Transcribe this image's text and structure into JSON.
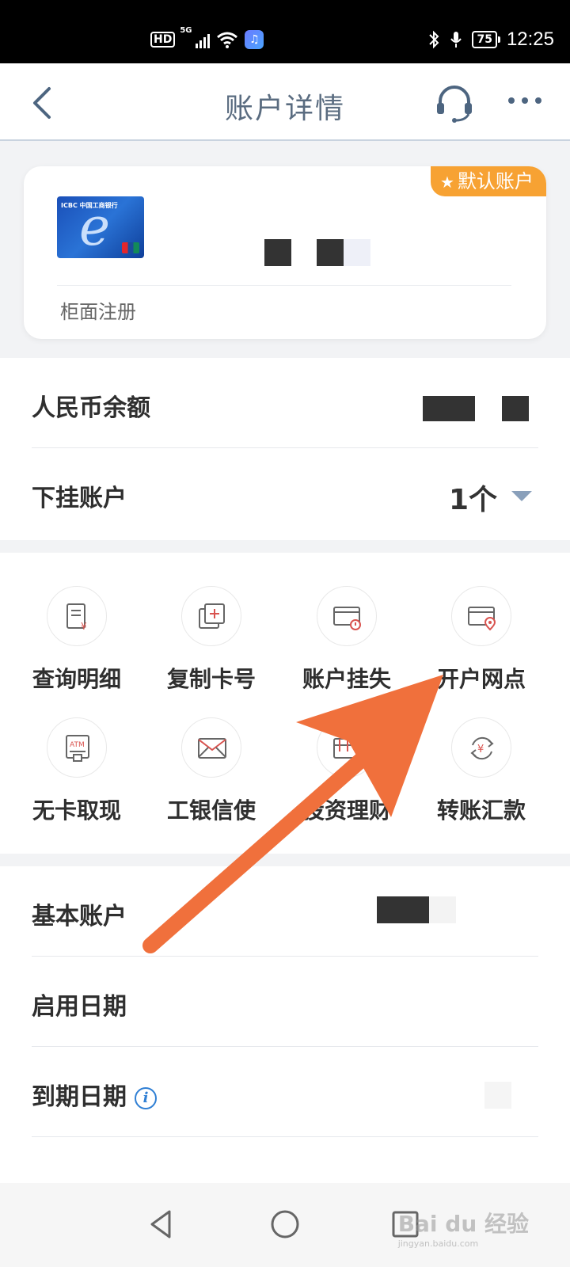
{
  "status_bar": {
    "hd": "HD",
    "network": "5G",
    "battery": "75",
    "time": "12:25"
  },
  "header": {
    "title": "账户详情",
    "back_icon": "chevron-left-icon",
    "service_icon": "headset-icon",
    "more_icon": "more-dots-icon"
  },
  "card": {
    "badge": "默认账户",
    "badge_color": "#f7a233",
    "card_brand": "ICBC 中国工商银行",
    "registration": "柜面注册"
  },
  "info": {
    "balance_label": "人民币余额",
    "sub_accounts_label": "下挂账户",
    "sub_accounts_count": "1个"
  },
  "actions": [
    {
      "label": "查询明细",
      "icon": "statement-yuan-icon"
    },
    {
      "label": "复制卡号",
      "icon": "copy-card-icon"
    },
    {
      "label": "账户挂失",
      "icon": "card-alert-icon"
    },
    {
      "label": "开户网点",
      "icon": "card-location-icon"
    },
    {
      "label": "无卡取现",
      "icon": "atm-icon"
    },
    {
      "label": "工银信使",
      "icon": "envelope-icon"
    },
    {
      "label": "投资理财",
      "icon": "finance-icon"
    },
    {
      "label": "转账汇款",
      "icon": "transfer-yuan-icon"
    }
  ],
  "details": {
    "basic_account_label": "基本账户",
    "start_date_label": "启用日期",
    "expiry_date_label": "到期日期"
  },
  "watermark": {
    "text": "Bai du 经验",
    "sub": "jingyan.baidu.com"
  },
  "colors": {
    "accent_arrow": "#f0703c",
    "title_text": "#5a6c80",
    "info_blue": "#2f7fd4"
  }
}
